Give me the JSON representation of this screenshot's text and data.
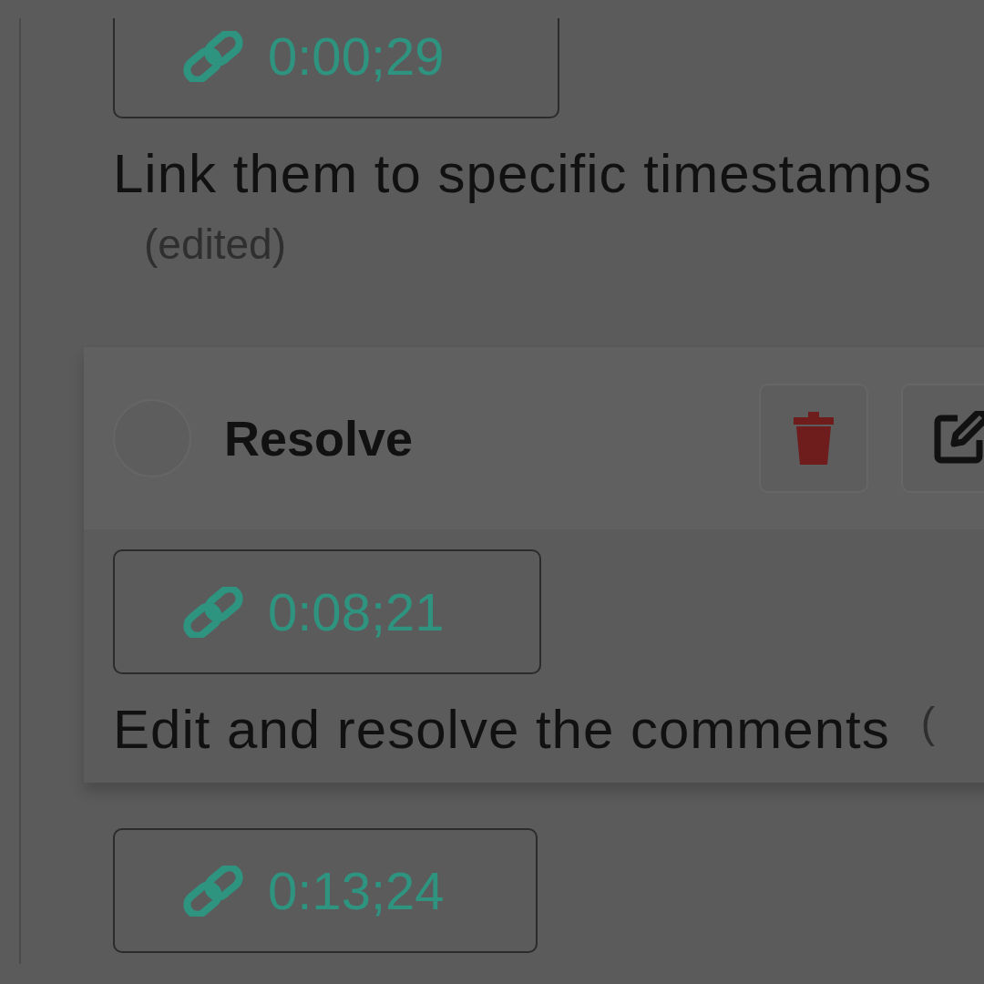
{
  "comments": [
    {
      "selected": false,
      "timestamp": "0:00;29",
      "text": "Link them to specific timestamps",
      "edited_label": "(edited)"
    },
    {
      "selected": true,
      "resolve": {
        "label": "Resolve",
        "checked": false
      },
      "timestamp": "0:08;21",
      "text": "Edit and resolve the comments",
      "edited_label": "("
    },
    {
      "selected": false,
      "timestamp": "0:13;24"
    }
  ]
}
